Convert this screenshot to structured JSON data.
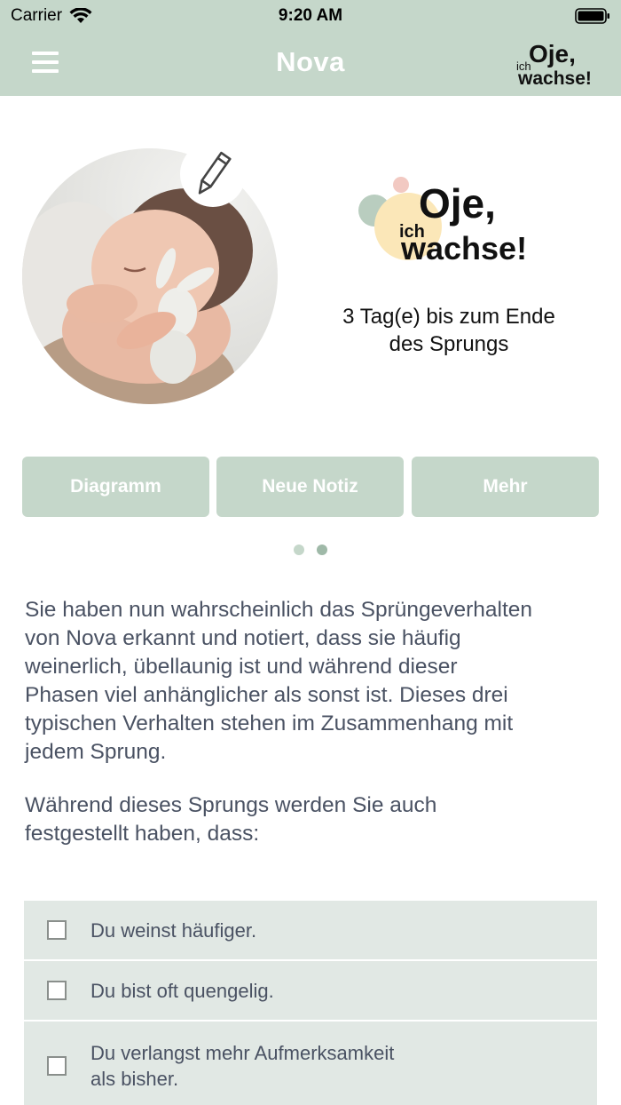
{
  "status_bar": {
    "carrier": "Carrier",
    "time": "9:20 AM"
  },
  "nav": {
    "title": "Nova",
    "logo": {
      "line1": "Oje,",
      "line2": "ich",
      "line3": "wachse!"
    }
  },
  "hero": {
    "photo_icon": "baby-photo",
    "edit_icon": "pencil-icon",
    "brand_logo": {
      "line1": "Oje,",
      "line2": "ich",
      "line3": "wachse!"
    },
    "leap_line1": "3 Tag(e) bis zum Ende",
    "leap_line2": "des Sprungs"
  },
  "actions": [
    {
      "label": "Diagramm"
    },
    {
      "label": "Neue Notiz"
    },
    {
      "label": "Mehr"
    }
  ],
  "pager": {
    "count": 2,
    "active_index": 1
  },
  "content": {
    "paragraph1_lines": [
      "Sie haben nun wahrscheinlich das Sprüngeverhalten",
      "von Nova erkannt und notiert, dass sie häufig",
      "weinerlich, übellaunig ist und während dieser",
      "Phasen viel anhänglicher als sonst ist. Dieses drei",
      "typischen Verhalten stehen im Zusammenhang mit",
      "jedem Sprung."
    ],
    "paragraph2_lines": [
      "Während dieses Sprungs werden Sie auch",
      "festgestellt haben, dass:"
    ]
  },
  "checklist": [
    {
      "lines": [
        "Du weinst häufiger."
      ],
      "checked": false
    },
    {
      "lines": [
        "Du bist oft quengelig."
      ],
      "checked": false
    },
    {
      "lines": [
        "Du verlangst mehr Aufmerksamkeit",
        "als bisher."
      ],
      "checked": false
    }
  ],
  "colors": {
    "accent": "#c5d7ca",
    "accent_dark": "#9fb9a8",
    "row_bg": "#e1e8e4",
    "text": "#4a5263"
  }
}
